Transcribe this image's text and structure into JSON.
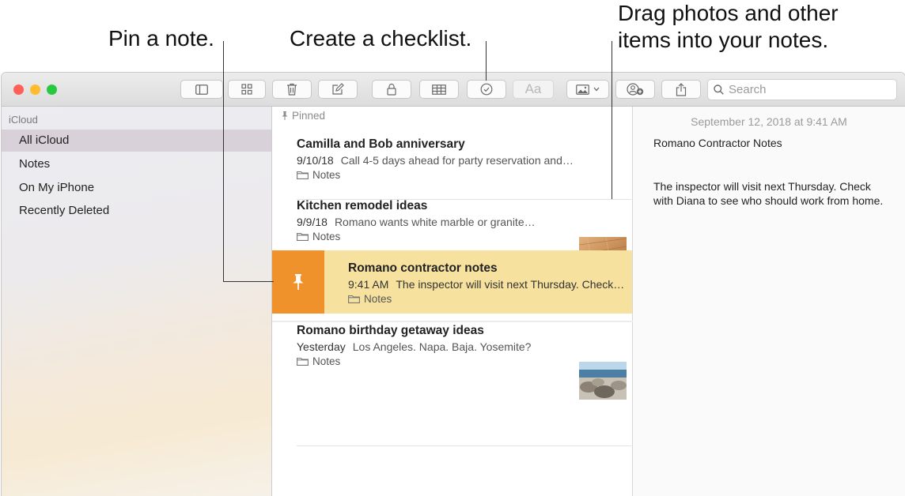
{
  "callouts": {
    "pin": "Pin a note.",
    "checklist": "Create a checklist.",
    "drag_line1": "Drag photos and other",
    "drag_line2": "items into your notes."
  },
  "toolbar": {
    "icons": [
      "sidebar-toggle-icon",
      "gallery-grid-icon",
      "trash-icon",
      "compose-icon",
      "lock-icon",
      "table-icon",
      "checklist-icon",
      "format-text-icon",
      "media-icon",
      "add-people-icon",
      "share-icon"
    ],
    "format_label": "Aa",
    "search_placeholder": "Search"
  },
  "sidebar": {
    "header": "iCloud",
    "items": [
      {
        "label": "All iCloud",
        "selected": true
      },
      {
        "label": "Notes",
        "selected": false
      },
      {
        "label": "On My iPhone",
        "selected": false
      },
      {
        "label": "Recently Deleted",
        "selected": false
      }
    ]
  },
  "list": {
    "pinned_header": "Pinned",
    "notes": [
      {
        "title": "Camilla and Bob anniversary",
        "date": "9/10/18",
        "snippet": "Call 4-5 days ahead for party reservation and…",
        "folder": "Notes",
        "thumbnail": null
      },
      {
        "title": "Kitchen remodel ideas",
        "date": "9/9/18",
        "snippet": "Romano wants white marble or granite…",
        "folder": "Notes",
        "thumbnail": "wood-floor"
      },
      {
        "title": "Romano contractor notes",
        "date": "9:41 AM",
        "snippet": "The inspector will visit next Thursday. Check…",
        "folder": "Notes",
        "thumbnail": null,
        "swiped": true
      },
      {
        "title": "Romano birthday getaway ideas",
        "date": "Yesterday",
        "snippet": "Los Angeles. Napa. Baja. Yosemite?",
        "folder": "Notes",
        "thumbnail": "beach-rocks"
      }
    ]
  },
  "editor": {
    "date": "September 12, 2018 at 9:41 AM",
    "title": "Romano Contractor Notes",
    "body": "The inspector will visit next Thursday. Check with Diana to see who should work from home."
  },
  "colors": {
    "close": "#fe5f57",
    "minimize": "#febc2e",
    "zoom": "#28c840",
    "swipe_pin": "#f0922c",
    "swipe_highlight": "#f6e29e",
    "sidebar_selected": "#d9d1d9"
  }
}
